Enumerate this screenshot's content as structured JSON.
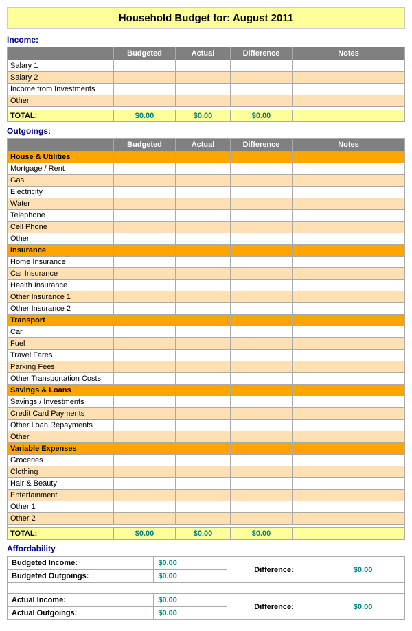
{
  "title": {
    "prefix": "Household Budget for:",
    "month": "August 2011",
    "full": "Household Budget for:   August 2011"
  },
  "income": {
    "section_label": "Income:",
    "columns": [
      "",
      "Budgeted",
      "Actual",
      "Difference",
      "Notes"
    ],
    "rows": [
      {
        "label": "Salary 1",
        "budgeted": "",
        "actual": "",
        "diff": "",
        "notes": ""
      },
      {
        "label": "Salary 2",
        "budgeted": "",
        "actual": "",
        "diff": "",
        "notes": ""
      },
      {
        "label": "Income from Investments",
        "budgeted": "",
        "actual": "",
        "diff": "",
        "notes": ""
      },
      {
        "label": "Other",
        "budgeted": "",
        "actual": "",
        "diff": "",
        "notes": ""
      }
    ],
    "total_label": "TOTAL:",
    "total_budgeted": "$0.00",
    "total_actual": "$0.00",
    "total_diff": "$0.00"
  },
  "outgoings": {
    "section_label": "Outgoings:",
    "columns": [
      "",
      "Budgeted",
      "Actual",
      "Difference",
      "Notes"
    ],
    "groups": [
      {
        "header": "House & Utilities",
        "rows": [
          "Mortgage / Rent",
          "Gas",
          "Electricity",
          "Water",
          "Telephone",
          "Cell Phone",
          "Other"
        ]
      },
      {
        "header": "Insurance",
        "rows": [
          "Home Insurance",
          "Car Insurance",
          "Health Insurance",
          "Other Insurance 1",
          "Other Insurance 2"
        ]
      },
      {
        "header": "Transport",
        "rows": [
          "Car",
          "Fuel",
          "Travel Fares",
          "Parking Fees",
          "Other Transportation Costs"
        ]
      },
      {
        "header": "Savings & Loans",
        "rows": [
          "Savings / Investments",
          "Credit Card Payments",
          "Other Loan Repayments",
          "Other"
        ]
      },
      {
        "header": "Variable Expenses",
        "rows": [
          "Groceries",
          "Clothing",
          "Hair & Beauty",
          "Entertainment",
          "Other 1",
          "Other 2"
        ]
      }
    ],
    "total_label": "TOTAL:",
    "total_budgeted": "$0.00",
    "total_actual": "$0.00",
    "total_diff": "$0.00"
  },
  "affordability": {
    "section_label": "Affordability",
    "budgeted_income_label": "Budgeted Income:",
    "budgeted_income_value": "$0.00",
    "budgeted_outgoings_label": "Budgeted Outgoings:",
    "budgeted_outgoings_value": "$0.00",
    "budgeted_diff_label": "Difference:",
    "budgeted_diff_value": "$0.00",
    "actual_income_label": "Actual Income:",
    "actual_income_value": "$0.00",
    "actual_outgoings_label": "Actual Outgoings:",
    "actual_outgoings_value": "$0.00",
    "actual_diff_label": "Difference:",
    "actual_diff_value": "$0.00"
  }
}
